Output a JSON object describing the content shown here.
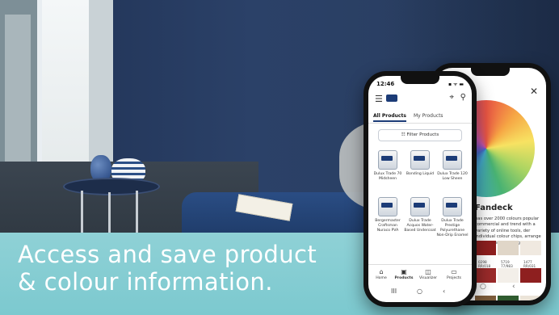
{
  "headline": {
    "line1": "Access and save product",
    "line2": "& colour information."
  },
  "front_phone": {
    "status_time": "12:46",
    "status_icons": "▪ ᯤ ▬",
    "tabs": [
      {
        "label": "All Products",
        "active": true
      },
      {
        "label": "My Products",
        "active": false
      }
    ],
    "filter_button": "☷ Filter Products",
    "products": [
      {
        "name": "Dulux Trade 70 Midsheen"
      },
      {
        "name": "Bonding Liquid"
      },
      {
        "name": "Dulux Trade 120 Low Sheen"
      },
      {
        "name": "Bergermaster Craftsman Nuraco PVA"
      },
      {
        "name": "Dulux Trade Acquos Water-Based Undercoat"
      },
      {
        "name": "Dulux Trade Prestige Polyurethane Non-Drip Enamel"
      }
    ],
    "bottom_nav": [
      {
        "label": "Home",
        "icon": "home-icon"
      },
      {
        "label": "Products",
        "icon": "products-icon"
      },
      {
        "label": "Visualizer",
        "icon": "visualizer-icon"
      },
      {
        "label": "Projects",
        "icon": "projects-icon"
      }
    ],
    "system_nav": {
      "recent": "III",
      "home": "○",
      "back": "‹"
    }
  },
  "back_phone": {
    "close_label": "✕",
    "title": "Fandeck",
    "text": "has over 2000 colours popular commercial and trend with a variety of online tools, der individual colour chips, arrange for anyone specifying",
    "swatch_colors": [
      "#8e1f1f",
      "#e0d6c8",
      "#f0e9e0",
      "#9a2a2a",
      "#f3efe9",
      "#8e1f1f",
      "#7c5c3b",
      "#2f5b2f",
      "#ebe4d8"
    ],
    "codes": [
      {
        "code": "0298",
        "sub": "RR/018"
      },
      {
        "code": "5719",
        "sub": "77/983"
      },
      {
        "code": "1477",
        "sub": "RR/031"
      }
    ],
    "system_nav": {
      "home": "○",
      "back": "‹"
    }
  }
}
